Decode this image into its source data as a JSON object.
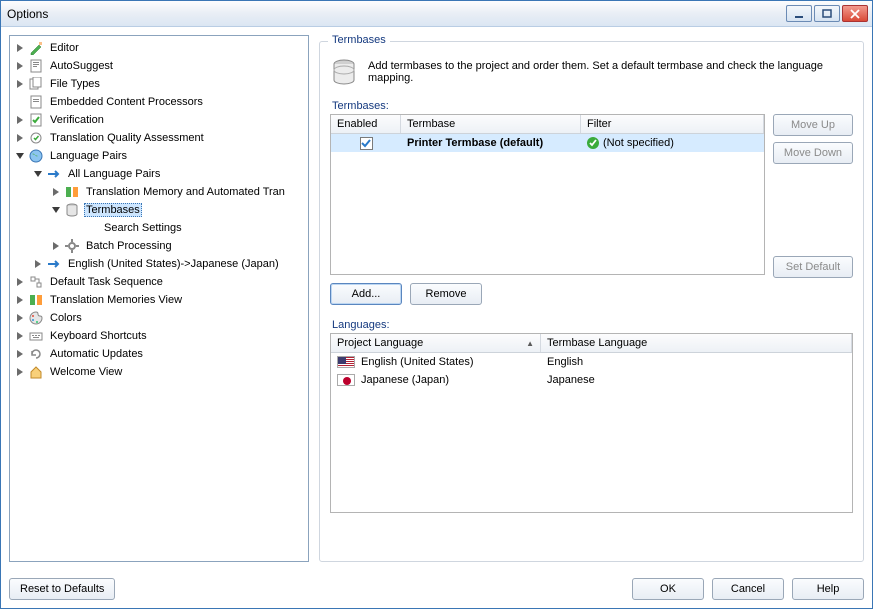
{
  "window": {
    "title": "Options"
  },
  "tree": {
    "editor": "Editor",
    "autosuggest": "AutoSuggest",
    "file_types": "File Types",
    "embedded": "Embedded Content Processors",
    "verification": "Verification",
    "tqa": "Translation Quality Assessment",
    "lang_pairs": "Language Pairs",
    "all_lang_pairs": "All Language Pairs",
    "tm_auto": "Translation Memory and Automated Tran",
    "termbases": "Termbases",
    "search_settings": "Search Settings",
    "batch": "Batch Processing",
    "en_ja": "English (United States)->Japanese (Japan)",
    "default_task": "Default Task Sequence",
    "tm_view": "Translation Memories View",
    "colors": "Colors",
    "kb_shortcuts": "Keyboard Shortcuts",
    "auto_updates": "Automatic Updates",
    "welcome": "Welcome View"
  },
  "panel": {
    "title": "Termbases",
    "description": "Add termbases to the project and order them. Set a default termbase and check the language mapping.",
    "termbases_label": "Termbases:",
    "headers": {
      "enabled": "Enabled",
      "termbase": "Termbase",
      "filter": "Filter"
    },
    "rows": [
      {
        "enabled": true,
        "name": "Printer Termbase (default)",
        "filter": "(Not specified)"
      }
    ],
    "buttons": {
      "move_up": "Move Up",
      "move_down": "Move Down",
      "set_default": "Set Default",
      "add": "Add...",
      "remove": "Remove"
    },
    "languages_label": "Languages:",
    "lang_headers": {
      "project": "Project Language",
      "termbase": "Termbase Language"
    },
    "lang_rows": [
      {
        "flag": "us",
        "project": "English (United States)",
        "termbase": "English"
      },
      {
        "flag": "jp",
        "project": "Japanese (Japan)",
        "termbase": "Japanese"
      }
    ]
  },
  "footer": {
    "reset": "Reset to Defaults",
    "ok": "OK",
    "cancel": "Cancel",
    "help": "Help"
  }
}
